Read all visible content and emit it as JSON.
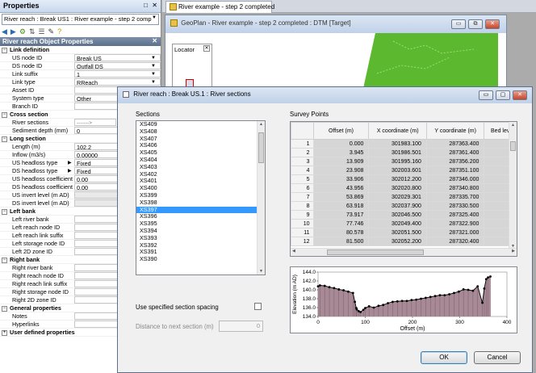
{
  "properties_panel": {
    "title": "Properties",
    "object_selector": "River reach : Break US1 : River example - step 2 comp",
    "object_header": "River reach Object Properties",
    "rows": [
      {
        "type": "cat",
        "label": "Link definition"
      },
      {
        "label": "US node ID",
        "value": "Break US",
        "dd": true
      },
      {
        "label": "DS node ID",
        "value": "Outfall DS",
        "dd": true
      },
      {
        "label": "Link suffix",
        "value": "1",
        "dd": true
      },
      {
        "label": "Link type",
        "value": "RReach",
        "dd": true
      },
      {
        "label": "Asset ID",
        "value": ""
      },
      {
        "label": "System type",
        "value": "Other",
        "dd": true
      },
      {
        "label": "Branch ID",
        "value": ""
      },
      {
        "type": "cat",
        "label": "Cross section"
      },
      {
        "label": "River sections",
        "value": "------->",
        "ell": true,
        "faded": true
      },
      {
        "label": "Sediment depth (mm)",
        "value": "0"
      },
      {
        "type": "cat",
        "label": "Long section"
      },
      {
        "label": "Length (m)",
        "value": "102.2"
      },
      {
        "label": "Inflow (m3/s)",
        "value": "0.00000"
      },
      {
        "label": "US headloss type",
        "value": "Fixed",
        "dd": true,
        "sub": true
      },
      {
        "label": "DS headloss type",
        "value": "Fixed",
        "dd": true,
        "sub": true
      },
      {
        "label": "US headloss coefficient",
        "value": "0.00"
      },
      {
        "label": "DS headloss coefficient",
        "value": "0.00"
      },
      {
        "label": "US invert level (m AD)",
        "value": "",
        "gray": true
      },
      {
        "label": "DS invert level (m AD)",
        "value": "",
        "gray": true
      },
      {
        "type": "cat",
        "label": "Left bank"
      },
      {
        "label": "Left river bank",
        "value": "",
        "ell": true
      },
      {
        "label": "Left reach node ID",
        "value": ""
      },
      {
        "label": "Left reach link suffix",
        "value": ""
      },
      {
        "label": "Left storage node ID",
        "value": ""
      },
      {
        "label": "Left 2D zone ID",
        "value": ""
      },
      {
        "type": "cat",
        "label": "Right bank"
      },
      {
        "label": "Right river bank",
        "value": "",
        "ell": true
      },
      {
        "label": "Right reach node ID",
        "value": ""
      },
      {
        "label": "Right reach link suffix",
        "value": ""
      },
      {
        "label": "Right storage node ID",
        "value": ""
      },
      {
        "label": "Right 2D zone ID",
        "value": ""
      },
      {
        "type": "cat",
        "label": "General properties"
      },
      {
        "label": "Notes",
        "value": "",
        "ell": true
      },
      {
        "label": "Hyperlinks",
        "value": "",
        "ell": true
      },
      {
        "type": "cat",
        "label": "User defined properties",
        "collapsed": true
      }
    ]
  },
  "doc_tab": {
    "label": "River example - step 2 completed"
  },
  "geoplan": {
    "title": "GeoPlan - River example - step 2 completed : DTM  [Target]",
    "locator_label": "Locator",
    "map_color": "#5cb82e"
  },
  "dialog": {
    "title": "River reach : Break US.1 : River sections",
    "sections_label": "Sections",
    "survey_label": "Survey Points",
    "sections": [
      "XS409",
      "XS408",
      "XS407",
      "XS406",
      "XS405",
      "XS404",
      "XS403",
      "XS402",
      "XS401",
      "XS400",
      "XS399",
      "XS398",
      "XS397",
      "XS396",
      "XS395",
      "XS394",
      "XS393",
      "XS392",
      "XS391",
      "XS390"
    ],
    "selected_section": "XS397",
    "columns": [
      "Offset (m)",
      "X coordinate (m)",
      "Y coordinate (m)",
      "Bed lev"
    ],
    "rows": [
      [
        "1",
        "0.000",
        "301983.100",
        "287363.400"
      ],
      [
        "2",
        "3.945",
        "301986.501",
        "287361.400"
      ],
      [
        "3",
        "13.909",
        "301995.160",
        "287356.200"
      ],
      [
        "4",
        "23.908",
        "302003.601",
        "287351.100"
      ],
      [
        "5",
        "33.906",
        "302012.200",
        "287346.000"
      ],
      [
        "6",
        "43.956",
        "302020.800",
        "287340.800"
      ],
      [
        "7",
        "53.869",
        "302029.301",
        "287335.700"
      ],
      [
        "8",
        "63.918",
        "302037.900",
        "287330.500"
      ],
      [
        "9",
        "73.917",
        "302046.500",
        "287325.400"
      ],
      [
        "10",
        "77.746",
        "302049.400",
        "287322.900"
      ],
      [
        "11",
        "80.578",
        "302051.500",
        "287321.000"
      ],
      [
        "12",
        "81.500",
        "302052.200",
        "287320.400"
      ]
    ],
    "spacing_label": "Use specified section spacing",
    "distance_label": "Distance to next section (m)",
    "distance_value": "0",
    "ok_label": "OK",
    "cancel_label": "Cancel"
  },
  "chart_data": {
    "type": "area",
    "xlabel": "Offset (m)",
    "ylabel": "Elevation (m AD)",
    "xlim": [
      0,
      400
    ],
    "ylim": [
      134.0,
      144.0
    ],
    "xticks": [
      "0",
      "100",
      "200",
      "300",
      "400"
    ],
    "yticks": [
      "134.0",
      "136.0",
      "138.0",
      "140.0",
      "142.0",
      "144.0"
    ],
    "x": [
      0,
      4,
      14,
      24,
      34,
      44,
      54,
      64,
      74,
      78,
      81,
      82,
      86,
      90,
      96,
      100,
      108,
      118,
      128,
      138,
      148,
      158,
      168,
      178,
      188,
      198,
      208,
      218,
      228,
      238,
      248,
      258,
      268,
      278,
      288,
      298,
      308,
      318,
      328,
      338,
      348,
      352,
      356,
      360,
      365
    ],
    "y": [
      140.8,
      141.0,
      140.9,
      140.6,
      140.4,
      140.1,
      139.9,
      139.6,
      139.3,
      137.3,
      135.9,
      135.6,
      135.2,
      135.0,
      135.5,
      135.9,
      136.3,
      136.0,
      136.4,
      136.6,
      137.0,
      137.3,
      137.4,
      137.5,
      137.5,
      137.7,
      137.8,
      138.0,
      138.2,
      138.4,
      138.6,
      138.8,
      138.8,
      139.0,
      139.3,
      139.6,
      140.1,
      140.0,
      139.8,
      140.8,
      137.1,
      140.3,
      142.4,
      142.8,
      143.0
    ],
    "fill_color": "#a88a96",
    "line_color": "#000000"
  }
}
